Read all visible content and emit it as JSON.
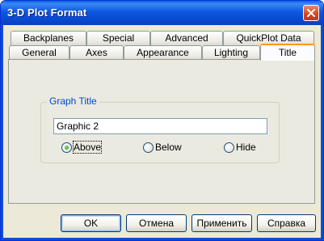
{
  "window": {
    "title": "3-D Plot Format"
  },
  "tabs_row_back": [
    {
      "label": "Backplanes"
    },
    {
      "label": "Special"
    },
    {
      "label": "Advanced"
    },
    {
      "label": "QuickPlot Data"
    }
  ],
  "tabs_row_front": [
    {
      "label": "General"
    },
    {
      "label": "Axes"
    },
    {
      "label": "Appearance"
    },
    {
      "label": "Lighting"
    },
    {
      "label": "Title"
    }
  ],
  "active_tab": "Title",
  "graph_title": {
    "legend": "Graph Title",
    "value": "Graphic 2",
    "position_options": [
      {
        "label": "Above",
        "selected": true
      },
      {
        "label": "Below",
        "selected": false
      },
      {
        "label": "Hide",
        "selected": false
      }
    ]
  },
  "buttons": {
    "ok": "OK",
    "cancel": "Отмена",
    "apply": "Применить",
    "help": "Справка"
  }
}
